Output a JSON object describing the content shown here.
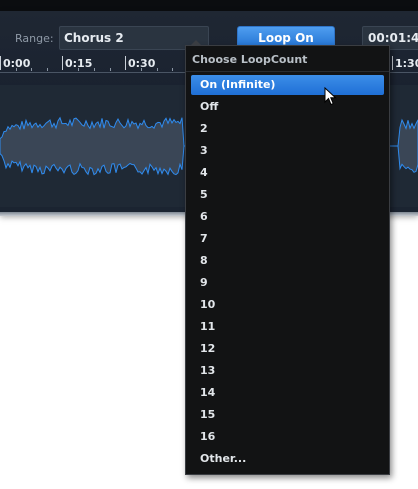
{
  "toolbar": {
    "range_label": "Range:",
    "range_value": "Chorus 2",
    "loop_button_label": "Loop On",
    "time_value": "00:01:4"
  },
  "ruler": {
    "labels": [
      "0:00",
      "0:15",
      "0:30",
      "1:30"
    ]
  },
  "waveform": {
    "color": "#2f8cf0",
    "fill": "#3a4656"
  },
  "loop_menu": {
    "header": "Choose LoopCount",
    "selected_index": 0,
    "items": [
      "On (Infinite)",
      "Off",
      "2",
      "3",
      "4",
      "5",
      "6",
      "7",
      "8",
      "9",
      "10",
      "11",
      "12",
      "13",
      "14",
      "15",
      "16",
      "Other..."
    ]
  },
  "colors": {
    "accent": "#2f7fe0",
    "panel": "#1c2430",
    "menu_bg": "#121314"
  }
}
